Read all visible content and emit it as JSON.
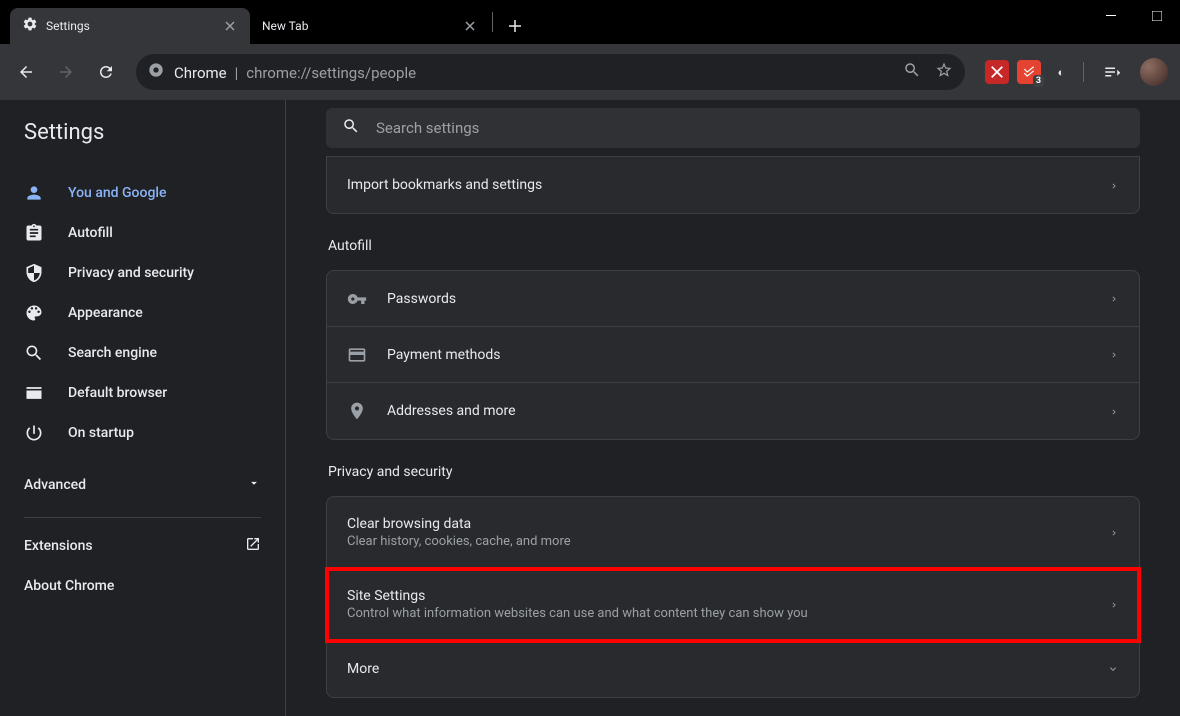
{
  "window": {
    "title": "Settings"
  },
  "tabs": [
    {
      "title": "Settings",
      "active": true
    },
    {
      "title": "New Tab",
      "active": false
    }
  ],
  "omnibox": {
    "prefix": "Chrome",
    "url": "chrome://settings/people"
  },
  "extensions": [
    {
      "name": "ext1",
      "bg": "#c62828",
      "content": ""
    },
    {
      "name": "todoist",
      "bg": "#e44332",
      "content": "",
      "badge": "3"
    },
    {
      "name": "ext3",
      "bg": "#202124",
      "content": ""
    }
  ],
  "sidebar": {
    "title": "Settings",
    "items": [
      {
        "label": "You and Google",
        "icon": "person",
        "active": true
      },
      {
        "label": "Autofill",
        "icon": "clipboard",
        "active": false
      },
      {
        "label": "Privacy and security",
        "icon": "shield",
        "active": false
      },
      {
        "label": "Appearance",
        "icon": "palette",
        "active": false
      },
      {
        "label": "Search engine",
        "icon": "search",
        "active": false
      },
      {
        "label": "Default browser",
        "icon": "browser",
        "active": false
      },
      {
        "label": "On startup",
        "icon": "power",
        "active": false
      }
    ],
    "advanced_label": "Advanced",
    "footer": [
      {
        "label": "Extensions",
        "external": true
      },
      {
        "label": "About Chrome",
        "external": false
      }
    ]
  },
  "search": {
    "placeholder": "Search settings"
  },
  "content": {
    "import_row": {
      "label": "Import bookmarks and settings"
    },
    "autofill": {
      "title": "Autofill",
      "rows": [
        {
          "label": "Passwords",
          "icon": "key"
        },
        {
          "label": "Payment methods",
          "icon": "card"
        },
        {
          "label": "Addresses and more",
          "icon": "pin"
        }
      ]
    },
    "privacy": {
      "title": "Privacy and security",
      "rows": [
        {
          "title": "Clear browsing data",
          "sub": "Clear history, cookies, cache, and more"
        },
        {
          "title": "Site Settings",
          "sub": "Control what information websites can use and what content they can show you",
          "highlight": true
        },
        {
          "title": "More",
          "expand": true
        }
      ]
    }
  }
}
